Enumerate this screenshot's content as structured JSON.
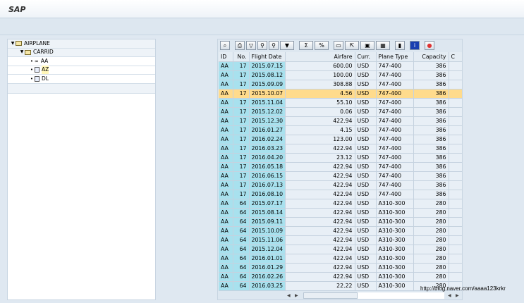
{
  "title": "SAP",
  "tree": {
    "root": "AIRPLANE",
    "group": "CARRID",
    "items": [
      {
        "label": "AA",
        "icon": "glasses-icon"
      },
      {
        "label": "AZ",
        "icon": "document-icon",
        "selected": true
      },
      {
        "label": "DL",
        "icon": "document-icon"
      }
    ]
  },
  "grid": {
    "columns": [
      "ID",
      "No.",
      "Flight Date",
      "Airfare",
      "Curr.",
      "Plane Type",
      "Capacity",
      "C"
    ],
    "rows": [
      [
        "AA",
        "17",
        "2015.07.15",
        "600.00",
        "USD",
        "747-400",
        "386"
      ],
      [
        "AA",
        "17",
        "2015.08.12",
        "100.00",
        "USD",
        "747-400",
        "386"
      ],
      [
        "AA",
        "17",
        "2015.09.09",
        "308.88",
        "USD",
        "747-400",
        "386"
      ],
      [
        "AA",
        "17",
        "2015.10.07",
        "4.56",
        "USD",
        "747-400",
        "386"
      ],
      [
        "AA",
        "17",
        "2015.11.04",
        "55.10",
        "USD",
        "747-400",
        "386"
      ],
      [
        "AA",
        "17",
        "2015.12.02",
        "0.06",
        "USD",
        "747-400",
        "386"
      ],
      [
        "AA",
        "17",
        "2015.12.30",
        "422.94",
        "USD",
        "747-400",
        "386"
      ],
      [
        "AA",
        "17",
        "2016.01.27",
        "4.15",
        "USD",
        "747-400",
        "386"
      ],
      [
        "AA",
        "17",
        "2016.02.24",
        "123.00",
        "USD",
        "747-400",
        "386"
      ],
      [
        "AA",
        "17",
        "2016.03.23",
        "422.94",
        "USD",
        "747-400",
        "386"
      ],
      [
        "AA",
        "17",
        "2016.04.20",
        "23.12",
        "USD",
        "747-400",
        "386"
      ],
      [
        "AA",
        "17",
        "2016.05.18",
        "422.94",
        "USD",
        "747-400",
        "386"
      ],
      [
        "AA",
        "17",
        "2016.06.15",
        "422.94",
        "USD",
        "747-400",
        "386"
      ],
      [
        "AA",
        "17",
        "2016.07.13",
        "422.94",
        "USD",
        "747-400",
        "386"
      ],
      [
        "AA",
        "17",
        "2016.08.10",
        "422.94",
        "USD",
        "747-400",
        "386"
      ],
      [
        "AA",
        "64",
        "2015.07.17",
        "422.94",
        "USD",
        "A310-300",
        "280"
      ],
      [
        "AA",
        "64",
        "2015.08.14",
        "422.94",
        "USD",
        "A310-300",
        "280"
      ],
      [
        "AA",
        "64",
        "2015.09.11",
        "422.94",
        "USD",
        "A310-300",
        "280"
      ],
      [
        "AA",
        "64",
        "2015.10.09",
        "422.94",
        "USD",
        "A310-300",
        "280"
      ],
      [
        "AA",
        "64",
        "2015.11.06",
        "422.94",
        "USD",
        "A310-300",
        "280"
      ],
      [
        "AA",
        "64",
        "2015.12.04",
        "422.94",
        "USD",
        "A310-300",
        "280"
      ],
      [
        "AA",
        "64",
        "2016.01.01",
        "422.94",
        "USD",
        "A310-300",
        "280"
      ],
      [
        "AA",
        "64",
        "2016.01.29",
        "422.94",
        "USD",
        "A310-300",
        "280"
      ],
      [
        "AA",
        "64",
        "2016.02.26",
        "422.94",
        "USD",
        "A310-300",
        "280"
      ],
      [
        "AA",
        "64",
        "2016.03.25",
        "22.22",
        "USD",
        "A310-300",
        "280"
      ]
    ],
    "highlighted_row": 3
  },
  "toolbar": [
    "details-icon",
    "print-icon",
    "filter-icon",
    "find-icon",
    "find-next-icon",
    "filter-menu-icon",
    "sum-icon",
    "subtotal-icon",
    "print-preview-icon",
    "export-icon",
    "view-icon",
    "layout-icon",
    "graphic-icon",
    "info-icon",
    "color-icon"
  ],
  "colors": {
    "key_column": "#a8e1ee",
    "highlight": "#ffdb8c",
    "background": "#dfe8f1"
  },
  "watermark": "http://blog.naver.com/aaaa123krkr"
}
